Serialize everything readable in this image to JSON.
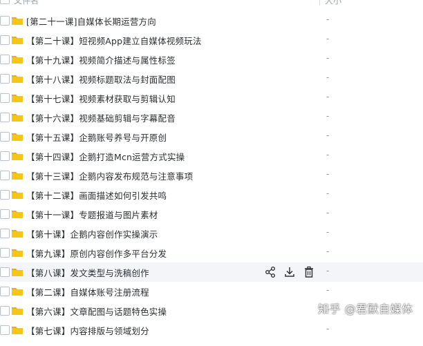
{
  "header": {
    "name_label": "文件名",
    "size_label": "大小"
  },
  "rows": [
    {
      "label": "[第二十一课]自媒体长期运营方向",
      "size": "-"
    },
    {
      "label": "【第二十课】短视频App建立自媒体视频玩法",
      "size": "-"
    },
    {
      "label": "【第十九课】视频简介描述与属性标签",
      "size": "-"
    },
    {
      "label": "【第十八课】视频标题取法与封面配图",
      "size": "-"
    },
    {
      "label": "【第十七课】视频素材获取与剪辑认知",
      "size": "-"
    },
    {
      "label": "【第十六课】视频基础剪辑与字幕配音",
      "size": "-"
    },
    {
      "label": "【第十五课】企鹅账号养号与开原创",
      "size": "-"
    },
    {
      "label": "【第十四课】企鹅打造Mcn运营方式实操",
      "size": "-"
    },
    {
      "label": "【第十三课】企鹅内容发布规范与注意事项",
      "size": "-"
    },
    {
      "label": "【第十二课】画面描述如何引发共鸣",
      "size": "-"
    },
    {
      "label": "【第十一课】专题报道与图片素材",
      "size": "-"
    },
    {
      "label": "【第十课】企鹅内容创作实操演示",
      "size": "-"
    },
    {
      "label": "【第九课】原创内容创作多平台分发",
      "size": "-"
    },
    {
      "label": "【第八课】发文类型与洗稿创作",
      "size": "-"
    },
    {
      "label": "【第二课】自媒体账号注册流程",
      "size": "-"
    },
    {
      "label": "【第六课】文章配图与话题特色实操",
      "size": "-"
    },
    {
      "label": "【第七课】内容排版与领域划分",
      "size": "-"
    }
  ],
  "hover_row_index": 13,
  "row_actions": [
    "share-icon",
    "download-icon",
    "trash-icon"
  ],
  "watermark": "知乎 @君默自媒体",
  "colors": {
    "folder": "#f5c518",
    "folder_dark": "#e6b000",
    "hover_bg": "#f3f5f8",
    "text": "#2c2f33"
  }
}
